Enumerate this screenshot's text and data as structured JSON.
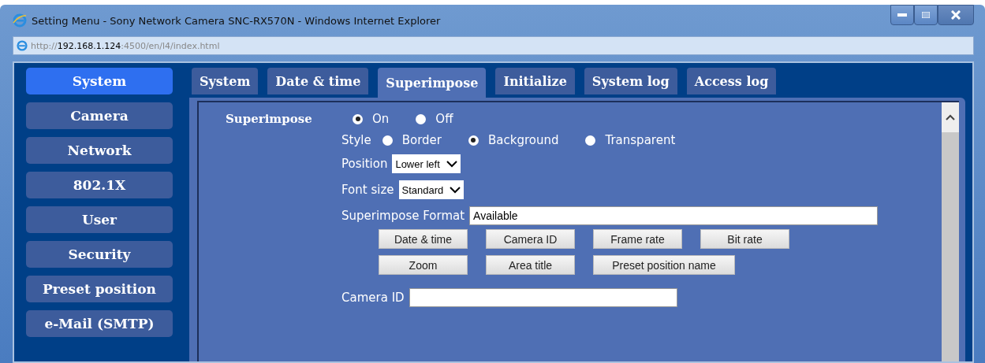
{
  "window": {
    "title": "Setting Menu - Sony Network Camera SNC-RX570N - Windows Internet Explorer"
  },
  "address": {
    "prefix": "http://",
    "host": "192.168.1.124",
    "rest": ":4500/en/l4/index.html"
  },
  "sidebar": {
    "items": [
      {
        "label": "System",
        "selected": true
      },
      {
        "label": "Camera",
        "selected": false
      },
      {
        "label": "Network",
        "selected": false
      },
      {
        "label": "802.1X",
        "selected": false
      },
      {
        "label": "User",
        "selected": false
      },
      {
        "label": "Security",
        "selected": false
      },
      {
        "label": "Preset position",
        "selected": false
      },
      {
        "label": "e-Mail (SMTP)",
        "selected": false
      }
    ]
  },
  "tabs": [
    {
      "label": "System",
      "selected": false
    },
    {
      "label": "Date & time",
      "selected": false
    },
    {
      "label": "Superimpose",
      "selected": true
    },
    {
      "label": "Initialize",
      "selected": false
    },
    {
      "label": "System log",
      "selected": false
    },
    {
      "label": "Access log",
      "selected": false
    }
  ],
  "form": {
    "superimpose": {
      "label": "Superimpose",
      "options": [
        {
          "label": "On",
          "selected": true
        },
        {
          "label": "Off",
          "selected": false
        }
      ]
    },
    "style": {
      "label": "Style",
      "options": [
        {
          "label": "Border",
          "selected": false
        },
        {
          "label": "Background",
          "selected": true
        },
        {
          "label": "Transparent",
          "selected": false
        }
      ]
    },
    "position": {
      "label": "Position",
      "value": "Lower left"
    },
    "font_size": {
      "label": "Font size",
      "value": "Standard"
    },
    "format": {
      "label": "Superimpose Format",
      "value": "Available",
      "buttons": [
        "Date & time",
        "Camera ID",
        "Frame rate",
        "Bit rate",
        "Zoom",
        "Area title",
        "Preset position name"
      ]
    },
    "camera_id": {
      "label": "Camera ID"
    }
  }
}
